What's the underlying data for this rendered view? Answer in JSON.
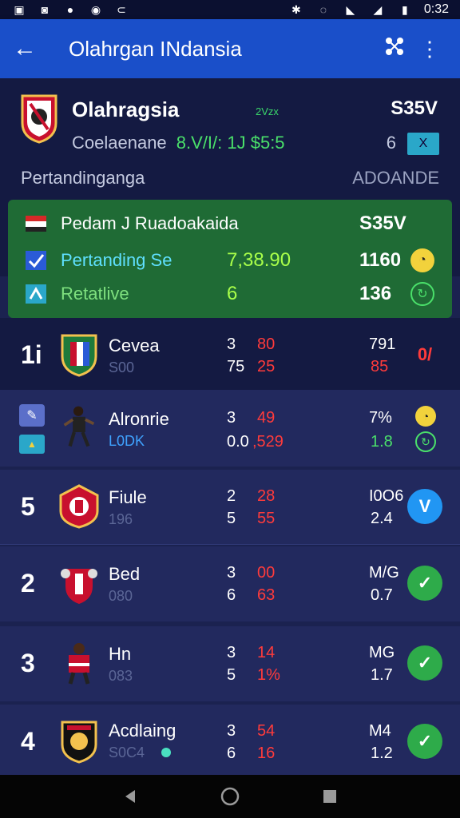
{
  "statusbar": {
    "time": "0:32"
  },
  "appbar": {
    "title": "Olahrgan INdansia"
  },
  "league": {
    "name": "Olahragsia",
    "small": "2Vzx",
    "score": "S35V",
    "sub_label": "Coelaenane",
    "sub_value": "8.V/I/: 1J $5:5",
    "num": "6",
    "badge": "X"
  },
  "section": {
    "title": "Pertandinganga",
    "right": "ADOANDE"
  },
  "highlight": {
    "rows": [
      {
        "label": "Pedam J Ruadoakaida",
        "mid": "",
        "right": "S35V"
      },
      {
        "label": "Pertanding Se",
        "mid": "7,38.90",
        "right": "1160"
      },
      {
        "label": "Retatlive",
        "mid": "6",
        "right": "136"
      }
    ]
  },
  "teams": [
    {
      "rank": "1i",
      "name": "Cevea",
      "sub": "S00",
      "w1": "3",
      "r1": "80",
      "w2": "75",
      "r2": "25",
      "p1": "791",
      "p2": "85",
      "act": "0/"
    },
    {
      "rank": "",
      "name": "Alronrie",
      "sub": "L0DK",
      "w1": "3",
      "r1": "49",
      "w2": "0.0",
      "r2": ",529",
      "p1": "7%",
      "p2": "1.8",
      "act": ""
    },
    {
      "rank": "5",
      "name": "Fiule",
      "sub": "196",
      "w1": "2",
      "r1": "28",
      "w2": "5",
      "r2": "55",
      "p1": "I0O6",
      "p2": "2.4",
      "act": "V"
    },
    {
      "rank": "2",
      "name": "Bed",
      "sub": "080",
      "w1": "3",
      "r1": "00",
      "w2": "6",
      "r2": "63",
      "p1": "M/G",
      "p2": "0.7",
      "act": "✓"
    },
    {
      "rank": "3",
      "name": "Hn",
      "sub": "083",
      "w1": "3",
      "r1": "14",
      "w2": "5",
      "r2": "1%",
      "p1": "MG",
      "p2": "1.7",
      "act": "✓"
    },
    {
      "rank": "4",
      "name": "Acdlaing",
      "sub": "S0C4",
      "w1": "3",
      "r1": "54",
      "w2": "6",
      "r2": "16",
      "p1": "M4",
      "p2": "1.2",
      "act": "✓"
    }
  ]
}
